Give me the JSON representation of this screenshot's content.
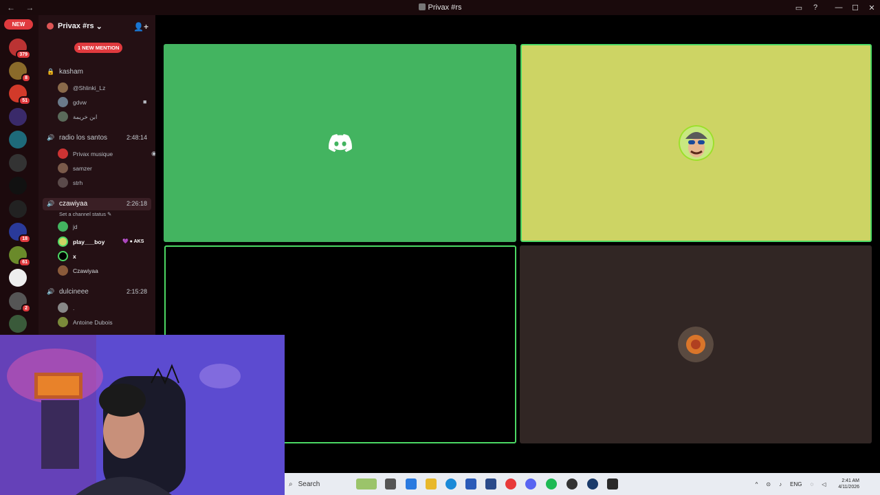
{
  "window": {
    "title": "Privax #rs",
    "nav": "← →",
    "controls": [
      "▭",
      "?",
      "—",
      "☐",
      "✕"
    ]
  },
  "rail": {
    "new_label": "NEW",
    "servers": [
      {
        "badge": "379",
        "color": "#b33"
      },
      {
        "badge": "8",
        "color": "#8a6a2a"
      },
      {
        "badge": "51",
        "color": "#d23a2a"
      },
      {
        "badge": "",
        "color": "#3a2a6a"
      },
      {
        "badge": "",
        "color": "#1e6a7a"
      },
      {
        "badge": "",
        "color": "#333"
      },
      {
        "badge": "",
        "color": "#111"
      },
      {
        "badge": "",
        "color": "#222"
      },
      {
        "badge": "18",
        "color": "#2a3a9a"
      },
      {
        "badge": "61",
        "color": "#6a8a2a"
      },
      {
        "badge": "",
        "color": "#eee"
      },
      {
        "badge": "2",
        "color": "#555"
      },
      {
        "badge": "",
        "color": "#3a5a3a"
      }
    ]
  },
  "sidebar": {
    "guild_name": "Privax #rs",
    "guild_chevron": "⌄",
    "mention_label": "1 NEW MENTION",
    "channels": {
      "kasham": {
        "name": "kasham"
      },
      "radio": {
        "name": "radio los santos",
        "time": "2:48:14"
      },
      "czawiyaa": {
        "name": "czawiyaa",
        "time": "2:26:18",
        "status": "Set a channel status"
      },
      "dulcineee": {
        "name": "dulcineee",
        "time": "2:15:28"
      }
    },
    "users": {
      "kasham": [
        "@Shlinki_Lz",
        "gdvw",
        "ابن خريمة"
      ],
      "radio": [
        "Privax musique",
        "samzer",
        "strh"
      ],
      "czawiyaa": [
        "jd",
        "play___boy",
        "x",
        "Czawiyaa"
      ],
      "czawiyaa_tag": "AKS",
      "dulcineee": [
        ".",
        "Antoine Dubois"
      ]
    }
  },
  "taskbar": {
    "search_placeholder": "Search",
    "lang": "ENG",
    "time": "2:41 AM",
    "date": "4/11/2026"
  },
  "colors": {
    "tile_green": "#43b460",
    "tile_yellow": "#cdd464",
    "speaking": "#4cd964",
    "mention": "#e03a3e"
  }
}
